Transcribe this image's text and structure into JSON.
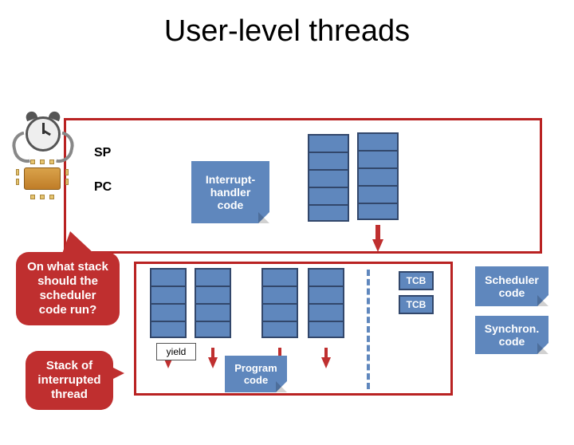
{
  "title": "User-level threads",
  "labels": {
    "sp": "SP",
    "pc": "PC"
  },
  "boxes": {
    "interrupt_handler": "Interrupt-\nhandler\ncode",
    "program_code": "Program\ncode",
    "yield": "yield",
    "scheduler": "Scheduler\ncode",
    "synchron": "Synchron.\ncode",
    "tcb": "TCB"
  },
  "callouts": {
    "question": "On what stack should the scheduler code run?",
    "answer": "Stack of interrupted thread"
  }
}
